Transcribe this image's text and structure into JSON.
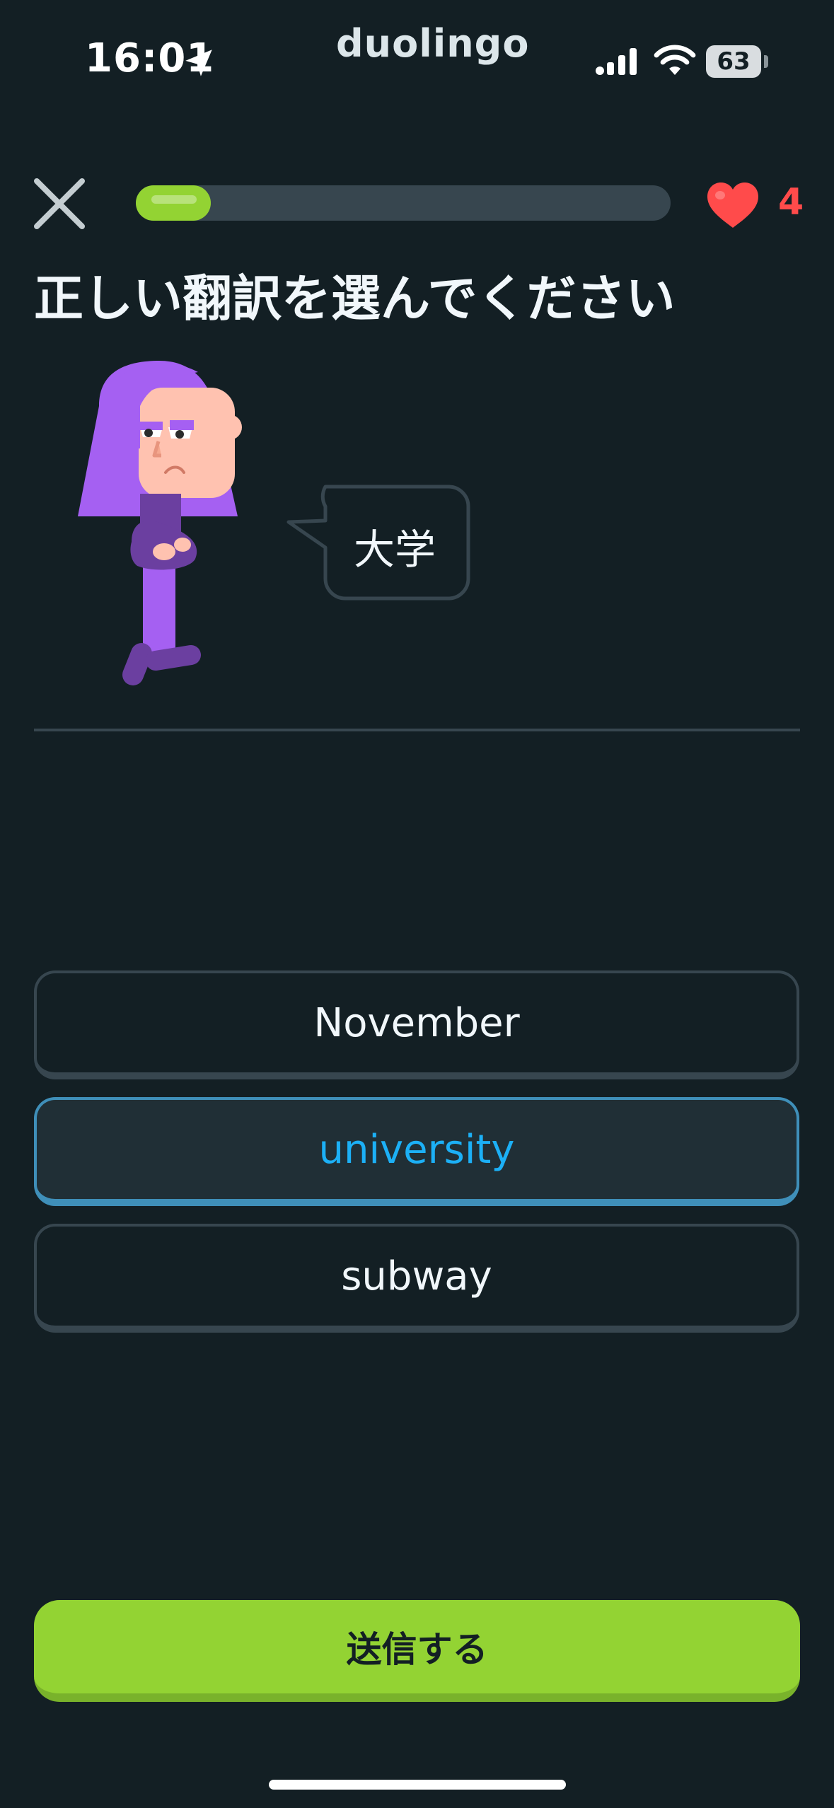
{
  "status_bar": {
    "time": "16:01",
    "app_name": "duolingo",
    "battery": "63",
    "icons": [
      "location-arrow-icon",
      "cellular-signal-icon",
      "wifi-icon",
      "battery-icon"
    ]
  },
  "lesson": {
    "progress_fraction": 0.14,
    "hearts": "4",
    "instruction": "正しい翻訳を選んでください",
    "prompt_word": "大学",
    "options": [
      "November",
      "university",
      "subway"
    ],
    "selected_index": 1,
    "submit_label": "送信する"
  },
  "colors": {
    "background": "#131f24",
    "progress": "#93d333",
    "heart": "#ff4b4b",
    "selected_text": "#1cb0f6",
    "selected_border": "#3f8fb9",
    "character_hair": "#a560f2"
  }
}
